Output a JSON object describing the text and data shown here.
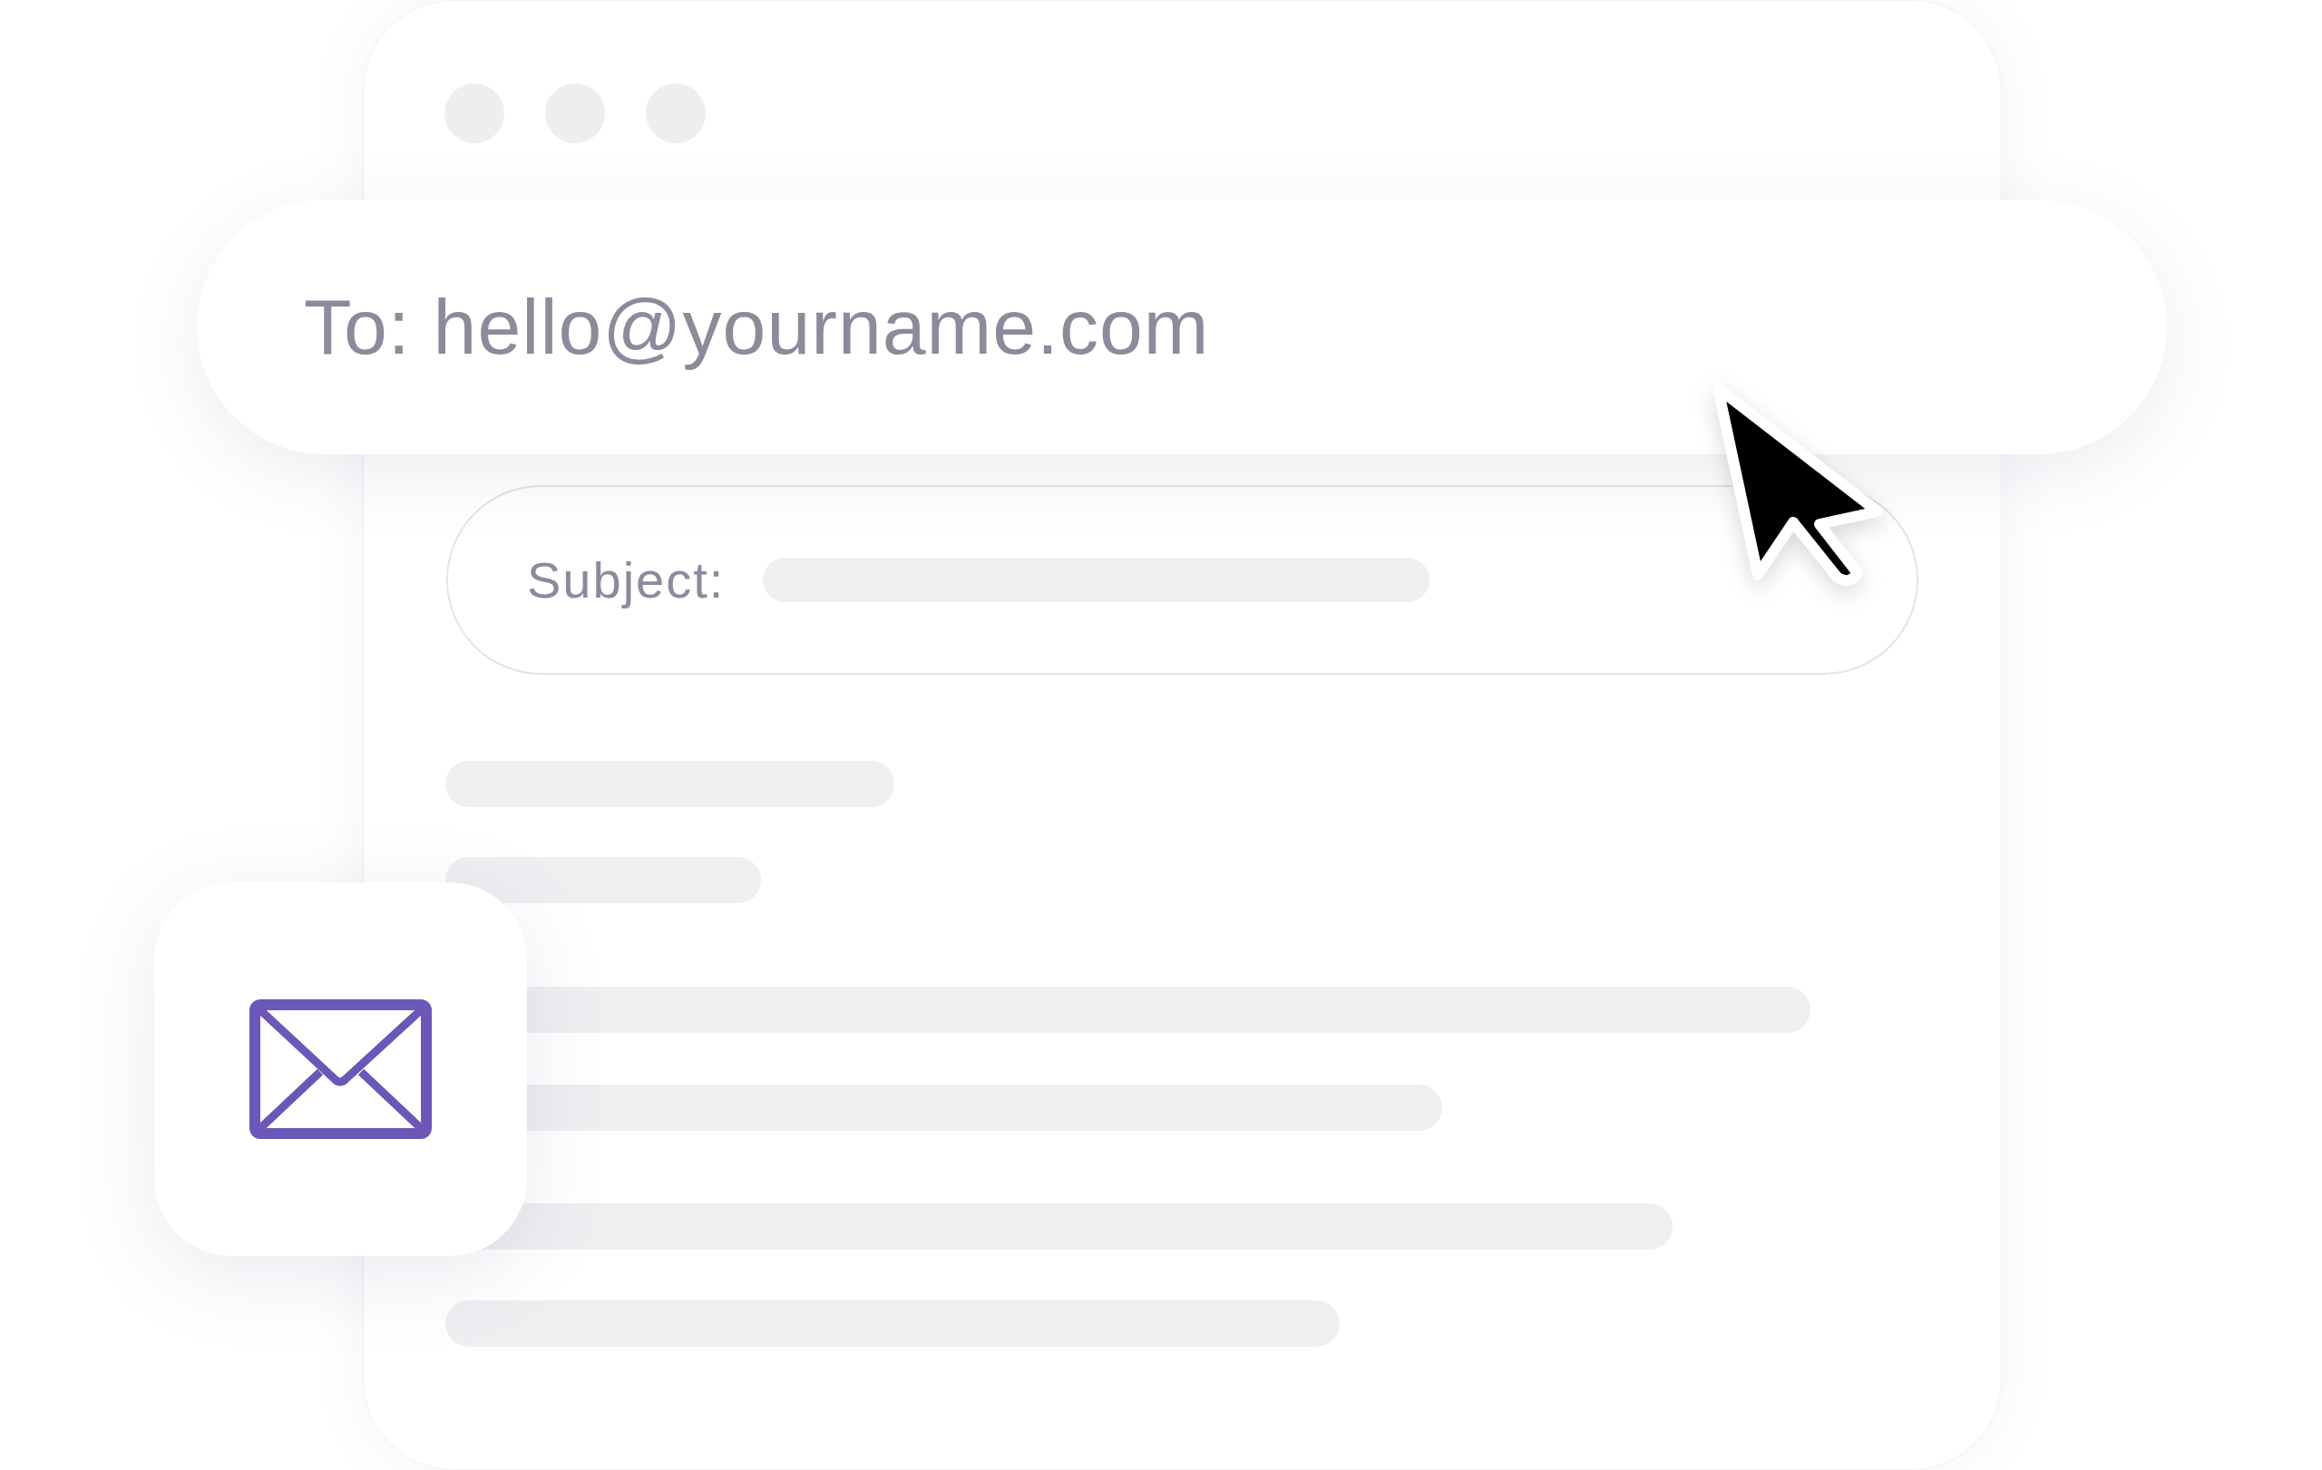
{
  "to_field": {
    "value": "To: hello@yourname.com"
  },
  "subject_field": {
    "label": "Subject:"
  }
}
